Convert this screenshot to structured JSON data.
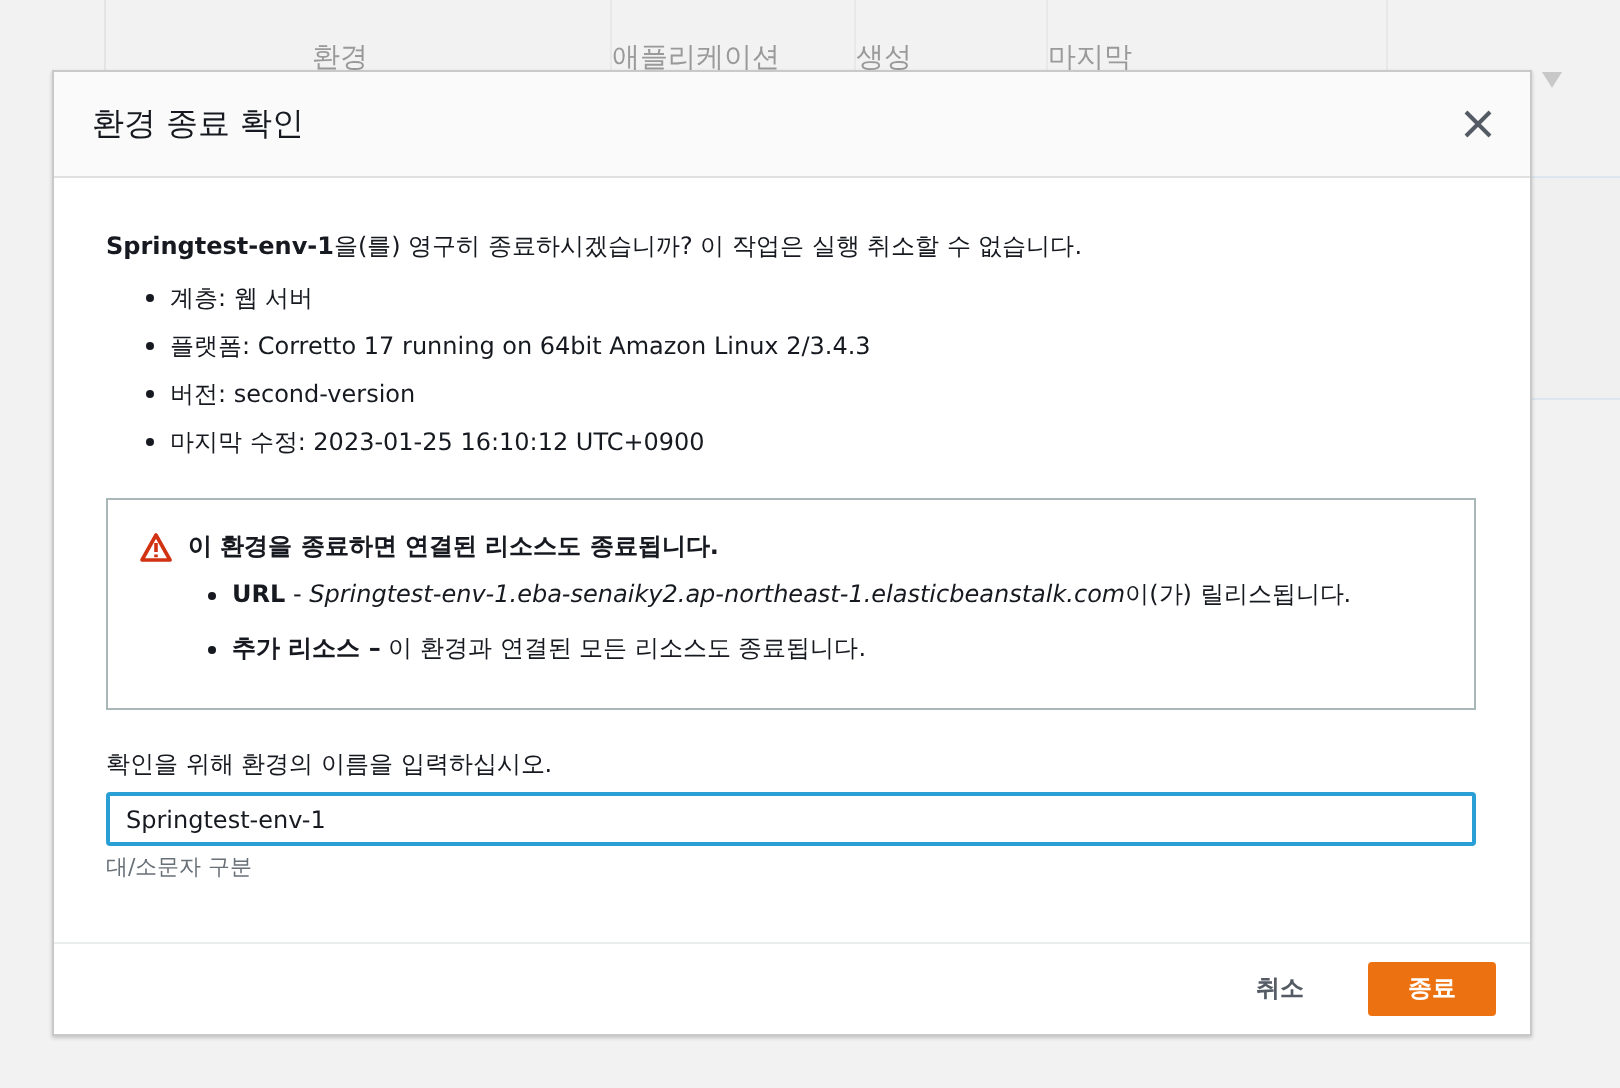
{
  "background_table": {
    "columns": [
      "환경",
      "애플리케이션",
      "생성",
      "마지막"
    ]
  },
  "dialog": {
    "title": "환경 종료 확인",
    "message": "**Springtest-env-1**을(를) 영구히 종료하시겠습니까? 이 작업은 실행 취소할 수 없습니다.",
    "details": [
      "계층: 웹 서버",
      "플랫폼: Corretto 17 running on 64bit Amazon Linux 2/3.4.3",
      "버전: second-version",
      "마지막 수정: 2023-01-25 16:10:12 UTC+0900"
    ],
    "warning": {
      "title": "이 환경을 종료하면 연결된 리소스도 종료됩니다.",
      "items": [
        {
          "label": "URL",
          "text": " - ",
          "link": "Springtest-env-1.eba-senaiky2.ap-northeast-1.elasticbeanstalk.com",
          "suffix": "이(가) 릴리스됩니다."
        },
        {
          "label": "추가 리소스 –",
          "text": " 이 환경과 연결된 모든 리소스도 종료됩니다."
        }
      ]
    },
    "confirm_field": {
      "label": "확인을 위해 환경의 이름을 입력하십시오.",
      "value": "Springtest-env-1",
      "focused": true,
      "hint": "대/소문자 구분"
    },
    "buttons": [
      {
        "kind": "link",
        "label": "취소"
      },
      {
        "kind": "primary",
        "label": "종료"
      }
    ]
  }
}
